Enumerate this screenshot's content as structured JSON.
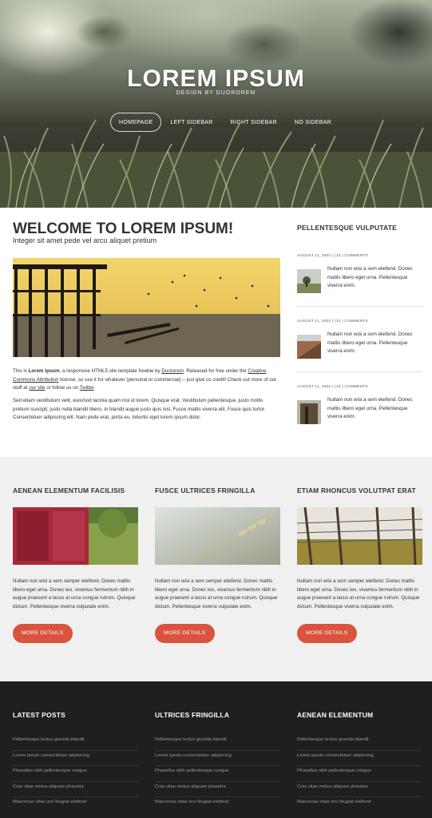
{
  "header": {
    "title": "LOREM IPSUM",
    "subtitle": "DESIGN BY DUOROREM",
    "nav": [
      "HOMEPAGE",
      "LEFT SIDEBAR",
      "RIGHT SIDEBAR",
      "NO SIDEBAR"
    ]
  },
  "main": {
    "heading": "WELCOME TO LOREM IPSUM!",
    "subheading": "Integer sit amet pede vel arcu aliquet pretium",
    "p1": {
      "a": "This is ",
      "b": "Lorem Ipsum",
      "c": ", a responsive HTML5 site template freebie by ",
      "link1": "Duororem",
      "d": ". Released for free under the ",
      "link2": "Creative Commons Attribution",
      "e": " license, so use it for whatever (personal or commercial) – just give us credit! Check out more of our stuff at ",
      "link3": "our site",
      "f": " or follow us on ",
      "link4": "Twitter",
      "g": "."
    },
    "p2": "Sed etiam vestibulum velit, euismod lacinia quam nisl id lorem. Quisque erat. Vestibulum pellentesque, justo mollis pretium suscipit, justo nulla blandit libero, in blandit augue justo quis nisl. Fusce mattis viverra elit. Fusce quis tortor. Consectetuer adipiscing elit. Nam pede erat, porta eu, lobortis eget lorem ipsum dolor."
  },
  "sidebar": {
    "title": "PELLENTESQUE VULPUTATE",
    "posts": [
      {
        "meta": "AUGUST 11, 2002 | (10 ) COMMENTS",
        "text": "Nullam non wisi a sem eleifend. Donec mattis libero eget urna. Pellentesque viverra enim."
      },
      {
        "meta": "AUGUST 11, 2002 | (10 ) COMMENTS",
        "text": "Nullam non wisi a sem eleifend. Donec mattis libero eget urna. Pellentesque viverra enim."
      },
      {
        "meta": "AUGUST 11, 2002 | (10 ) COMMENTS",
        "text": "Nullam non wisi a sem eleifend. Donec mattis libero eget urna. Pellentesque viverra enim."
      }
    ]
  },
  "features": [
    {
      "title": "AENEAN ELEMENTUM FACILISIS",
      "text": "Nullam non wisi a sem semper eleifend. Donec mattis libero eget urna. Donec leo, vivamus fermentum nibh in augue praesent a lacus at urna congue rutrum. Quisque dictum. Pellentesque viverra vulputate enim.",
      "button": "MORE DETAILS"
    },
    {
      "title": "FUSCE ULTRICES FRINGILLA",
      "text": "Nullam non wisi a sem semper eleifend. Donec mattis libero eget urna. Donec leo, vivamus fermentum nibh in augue praesent a lacus at urna congue rutrum. Quisque dictum. Pellentesque viverra vulputate enim.",
      "button": "MORE DETAILS"
    },
    {
      "title": "ETIAM RHONCUS VOLUTPAT ERAT",
      "text": "Nullam non wisi a sem semper eleifend. Donec mattis libero eget urna. Donec leo, vivamus fermentum nibh in augue praesent a lacus at urna congue rutrum. Quisque dictum. Pellentesque viverra vulputate enim.",
      "button": "MORE DETAILS"
    }
  ],
  "footer": [
    {
      "title": "LATEST POSTS",
      "items": [
        "Pellentesque lectus gravida blandit",
        "Lorem ipsum consectetuer adipiscing",
        "Phasellus nibh pellentesque congue",
        "Cras vitae metus aliquam pharetra",
        "Maecenas vitae orci feugiat eleifend"
      ]
    },
    {
      "title": "ULTRICES FRINGILLA",
      "items": [
        "Pellentesque lectus gravida blandit",
        "Lorem ipsum consectetuer adipiscing",
        "Phasellus nibh pellentesque congue",
        "Cras vitae metus aliquam pharetra",
        "Maecenas vitae orci feugiat eleifend"
      ]
    },
    {
      "title": "AENEAN ELEMENTUM",
      "items": [
        "Pellentesque lectus gravida blandit",
        "Lorem ipsum consectetuer adipiscing",
        "Phasellus nibh pellentesque congue",
        "Cras vitae metus aliquam pharetra",
        "Maecenas vitae orci feugiat eleifend"
      ]
    }
  ],
  "colors": {
    "accent": "#d9533d",
    "footer_bg": "#1f1f1f",
    "features_bg": "#f0f0f0"
  }
}
